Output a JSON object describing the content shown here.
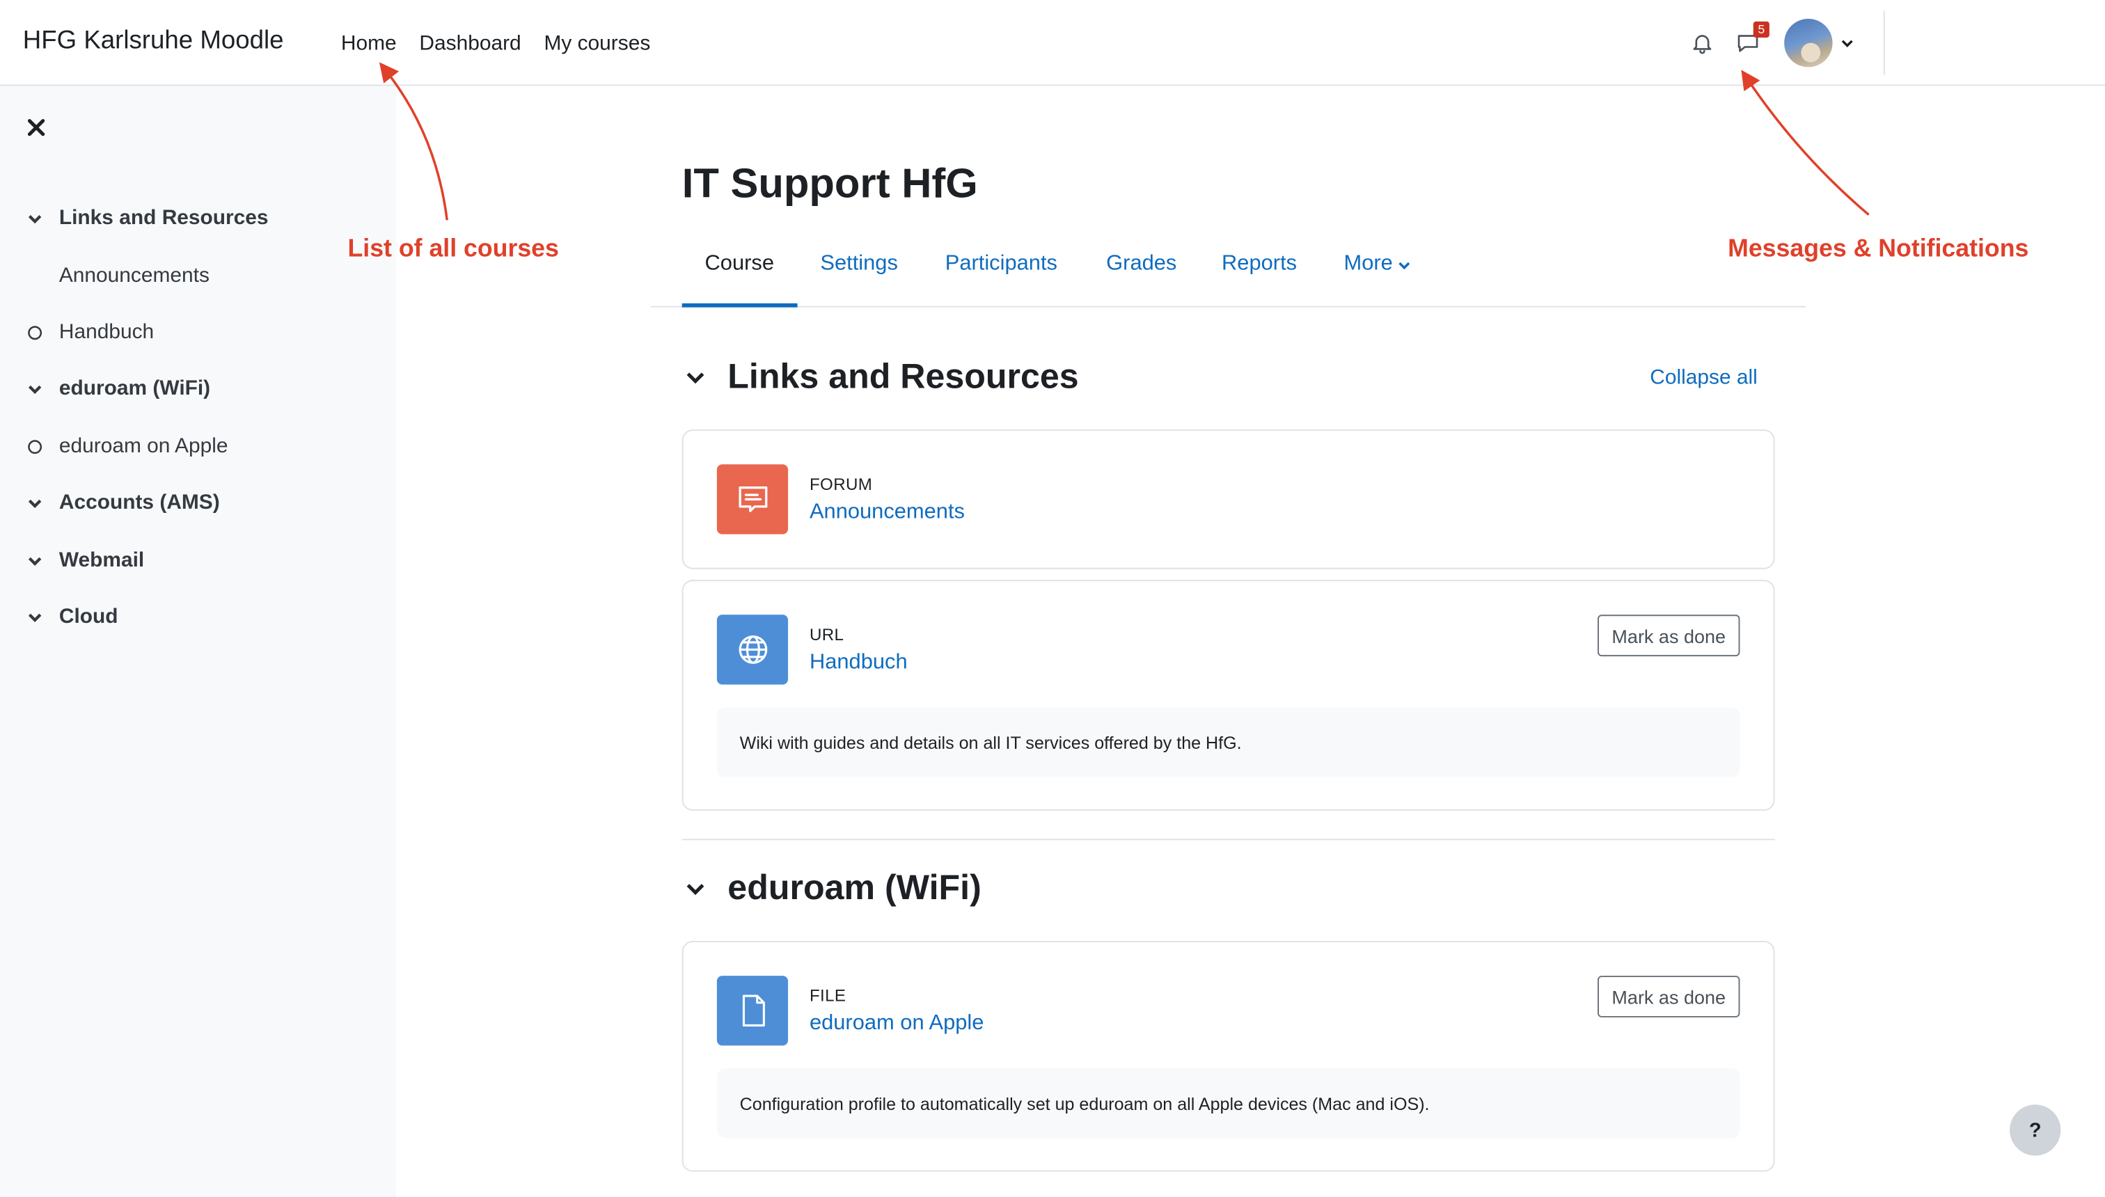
{
  "navbar": {
    "brand": "HFG Karlsruhe Moodle",
    "links": [
      "Home",
      "Dashboard",
      "My courses"
    ],
    "message_badge": "5"
  },
  "drawer": {
    "items": [
      {
        "label": "Links and Resources",
        "kind": "section"
      },
      {
        "label": "Announcements",
        "kind": "subitem"
      },
      {
        "label": "Handbuch",
        "kind": "activity"
      },
      {
        "label": "eduroam (WiFi)",
        "kind": "section"
      },
      {
        "label": "eduroam on Apple",
        "kind": "activity"
      },
      {
        "label": "Accounts (AMS)",
        "kind": "section"
      },
      {
        "label": "Webmail",
        "kind": "section"
      },
      {
        "label": "Cloud",
        "kind": "section"
      }
    ]
  },
  "course": {
    "title": "IT Support HfG",
    "tabs": [
      "Course",
      "Settings",
      "Participants",
      "Grades",
      "Reports",
      "More"
    ],
    "collapse_all": "Collapse all",
    "sections": [
      {
        "title": "Links and Resources",
        "activities": [
          {
            "type": "FORUM",
            "name": "Announcements",
            "color": "#e8674e",
            "icon": "forum-icon"
          },
          {
            "type": "URL",
            "name": "Handbuch",
            "color": "#4e8ed7",
            "icon": "globe-icon",
            "mark_done": "Mark as done",
            "description": "Wiki with guides and details on all IT services offered by the HfG."
          }
        ]
      },
      {
        "title": "eduroam (WiFi)",
        "activities": [
          {
            "type": "FILE",
            "name": "eduroam on Apple",
            "color": "#4e8ed7",
            "icon": "file-icon",
            "mark_done": "Mark as done",
            "description": "Configuration profile to automatically set up eduroam on all Apple devices (Mac and iOS)."
          }
        ]
      }
    ]
  },
  "help_button": "?",
  "annotations": {
    "courses": "List of all courses",
    "messages": "Messages & Notifications"
  },
  "colors": {
    "link": "#0f6cbf",
    "annotation": "#e0402a",
    "badge": "#ca3120"
  }
}
